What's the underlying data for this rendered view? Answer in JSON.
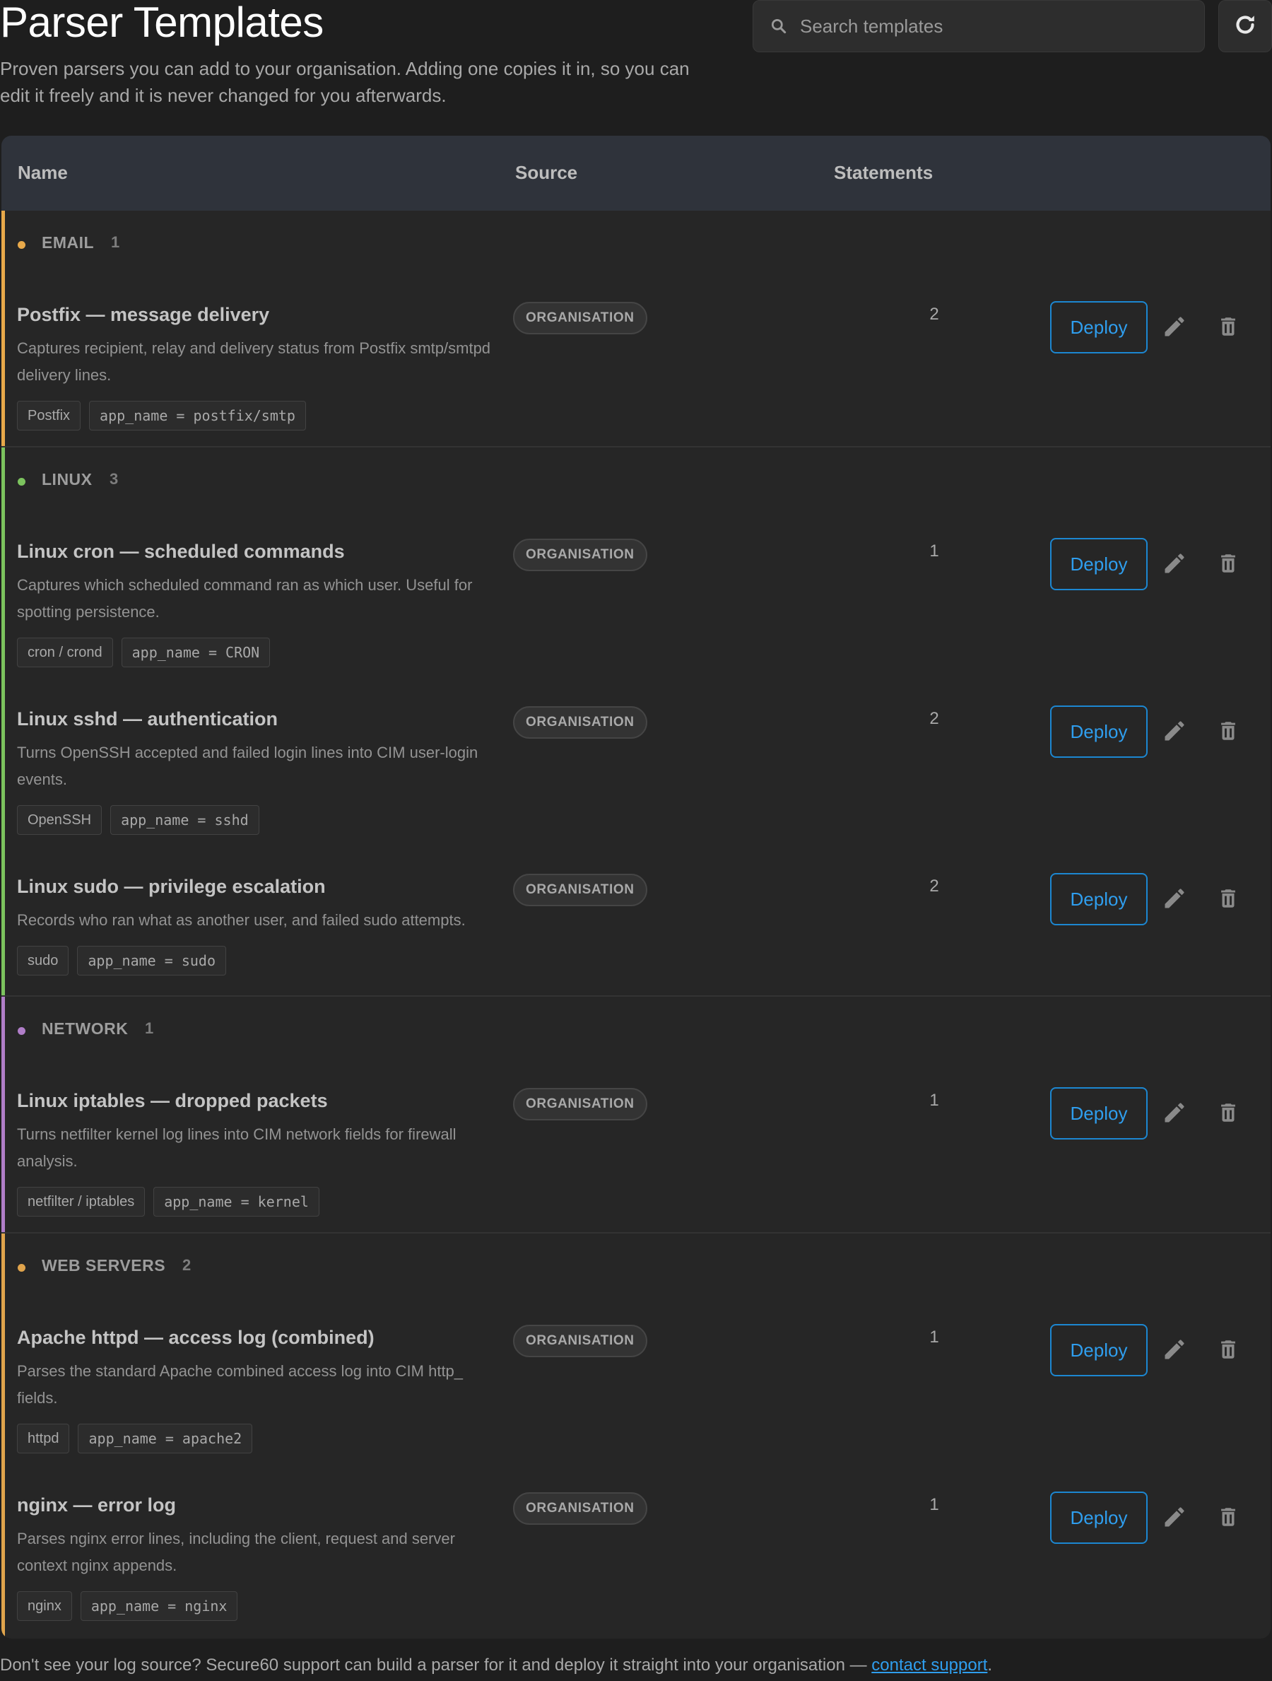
{
  "header": {
    "title": "Parser Templates",
    "description": "Proven parsers you can add to your organisation. Adding one copies it in, so you can edit it freely and it is never changed for you afterwards.",
    "search_placeholder": "Search templates"
  },
  "table": {
    "columns": {
      "name": "Name",
      "source": "Source",
      "statements": "Statements"
    },
    "action_label": "Deploy",
    "groups": [
      {
        "name": "EMAIL",
        "count": "1",
        "color": "#e8a94a",
        "rows": [
          {
            "title": "Postfix — message delivery",
            "desc": "Captures recipient, relay and delivery status from Postfix smtp/smtpd delivery lines.",
            "source": "ORGANISATION",
            "statements": "2",
            "tags": [
              "Postfix"
            ],
            "mono_tag": "app_name = postfix/smtp"
          }
        ]
      },
      {
        "name": "LINUX",
        "count": "3",
        "color": "#7cc35e",
        "rows": [
          {
            "title": "Linux cron — scheduled commands",
            "desc": "Captures which scheduled command ran as which user. Useful for spotting persistence.",
            "source": "ORGANISATION",
            "statements": "1",
            "tags": [
              "cron / crond"
            ],
            "mono_tag": "app_name = CRON"
          },
          {
            "title": "Linux sshd — authentication",
            "desc": "Turns OpenSSH accepted and failed login lines into CIM user-login events.",
            "source": "ORGANISATION",
            "statements": "2",
            "tags": [
              "OpenSSH"
            ],
            "mono_tag": "app_name = sshd"
          },
          {
            "title": "Linux sudo — privilege escalation",
            "desc": "Records who ran what as another user, and failed sudo attempts.",
            "source": "ORGANISATION",
            "statements": "2",
            "tags": [
              "sudo"
            ],
            "mono_tag": "app_name = sudo"
          }
        ]
      },
      {
        "name": "NETWORK",
        "count": "1",
        "color": "#b07ec8",
        "rows": [
          {
            "title": "Linux iptables — dropped packets",
            "desc": "Turns netfilter kernel log lines into CIM network fields for firewall analysis.",
            "source": "ORGANISATION",
            "statements": "1",
            "tags": [
              "netfilter / iptables"
            ],
            "mono_tag": "app_name = kernel"
          }
        ]
      },
      {
        "name": "WEB SERVERS",
        "count": "2",
        "color": "#e0a44c",
        "rows": [
          {
            "title": "Apache httpd — access log (combined)",
            "desc": "Parses the standard Apache combined access log into CIM http_ fields.",
            "source": "ORGANISATION",
            "statements": "1",
            "tags": [
              "httpd"
            ],
            "mono_tag": "app_name = apache2"
          },
          {
            "title": "nginx — error log",
            "desc": "Parses nginx error lines, including the client, request and server context nginx appends.",
            "source": "ORGANISATION",
            "statements": "1",
            "tags": [
              "nginx"
            ],
            "mono_tag": "app_name = nginx"
          }
        ]
      }
    ]
  },
  "footer": {
    "text": "Don't see your log source? Secure60 support can build a parser for it and deploy it straight into your organisation — ",
    "link": "contact support",
    "end": "."
  }
}
